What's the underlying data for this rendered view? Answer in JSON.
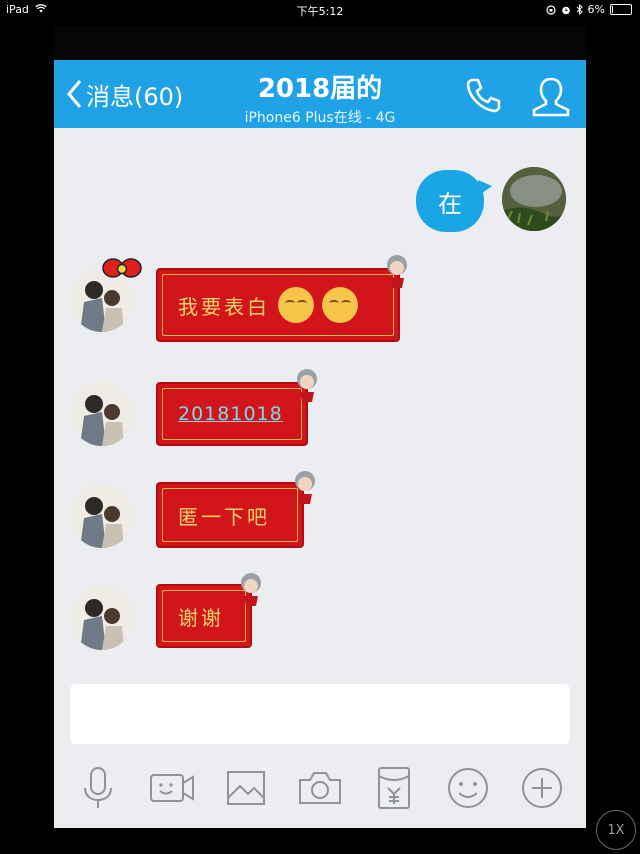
{
  "status_bar": {
    "device": "iPad",
    "time": "下午5:12",
    "battery": "6%",
    "battery_level": 0.06
  },
  "nav": {
    "back_label": "消息(60)",
    "title": "2018届的",
    "subtitle": "iPhone6 Plus在线 - 4G"
  },
  "messages": [
    {
      "from": "me",
      "type": "text",
      "text": "在"
    },
    {
      "from": "friend",
      "type": "red",
      "text": "我要表白",
      "emoji_count": 2
    },
    {
      "from": "friend",
      "type": "red",
      "text": "20181018",
      "link": true
    },
    {
      "from": "friend",
      "type": "red",
      "text": "匿一下吧"
    },
    {
      "from": "friend",
      "type": "red",
      "text": "谢谢"
    }
  ],
  "input": {
    "value": ""
  },
  "toolbar": [
    "microphone-icon",
    "video-icon",
    "image-icon",
    "camera-icon",
    "red-packet-icon",
    "emoji-icon",
    "plus-icon"
  ],
  "zoom": {
    "label": "1X"
  },
  "colors": {
    "nav": "#1fa3e6",
    "bubble_me": "#1aa6e5",
    "bubble_red": "#d2141b",
    "bubble_text": "#f5d36a",
    "background": "#ecedf1"
  }
}
